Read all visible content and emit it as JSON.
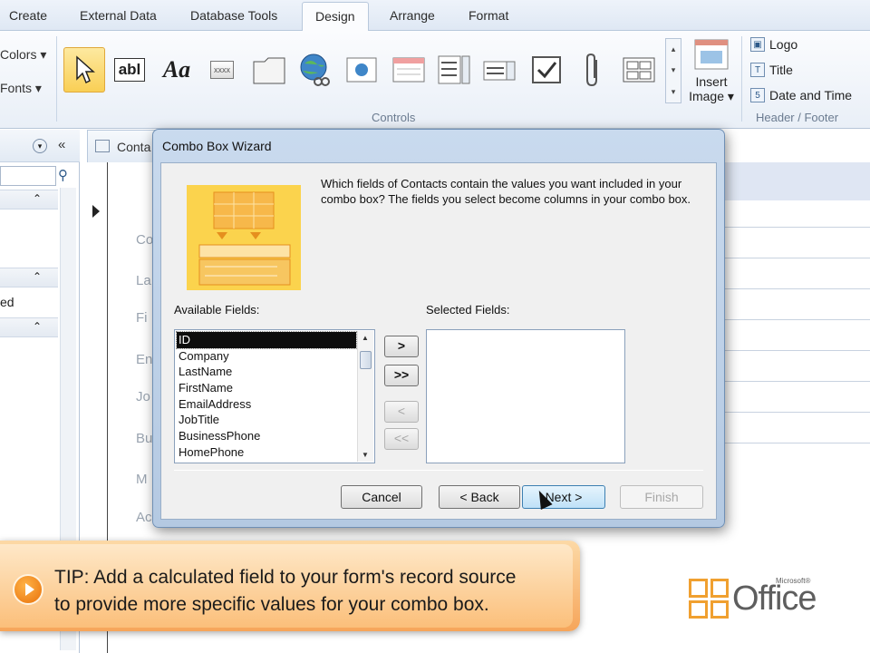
{
  "ribbon": {
    "tabs": [
      "Create",
      "External Data",
      "Database Tools",
      "Design",
      "Arrange",
      "Format"
    ],
    "left_items": [
      "Colors",
      "Fonts"
    ],
    "controls_group_label": "Controls",
    "controls_text_tool": "abl",
    "controls_label_tool": "Aa",
    "controls_combo_tool": "xxxx",
    "insert_image_label": "Insert Image",
    "header_footer": {
      "logo": "Logo",
      "title": "Title",
      "date_time": "Date and Time",
      "group_label": "Header / Footer"
    }
  },
  "document": {
    "tab_label": "Conta",
    "field_fragments": [
      "Co",
      "La",
      "Fi",
      "En",
      "Jo",
      "Bu",
      "M",
      "Ac"
    ],
    "nav_fragment": "ed"
  },
  "dialog": {
    "title": "Combo Box Wizard",
    "question": "Which fields of Contacts contain the values you want included in your combo box? The fields you select become columns in your combo box.",
    "available_label": "Available Fields:",
    "selected_label": "Selected Fields:",
    "available_fields": [
      "ID",
      "Company",
      "LastName",
      "FirstName",
      "EmailAddress",
      "JobTitle",
      "BusinessPhone",
      "HomePhone"
    ],
    "selected_index": 0,
    "move_buttons": {
      "add": ">",
      "add_all": ">>",
      "remove": "<",
      "remove_all": "<<"
    },
    "buttons": {
      "cancel": "Cancel",
      "back": "< Back",
      "next": "Next >",
      "finish": "Finish"
    }
  },
  "tip": {
    "line1": "TIP: Add a calculated field to your form's record source",
    "line2": "to provide more specific values for your combo box."
  },
  "logo": {
    "word": "Office",
    "sup": "Microsoft®"
  },
  "colors": {
    "tip_orange": "#f6a55a",
    "office_orange": "#f0a030",
    "dialog_frame": "#b4c9e2"
  }
}
